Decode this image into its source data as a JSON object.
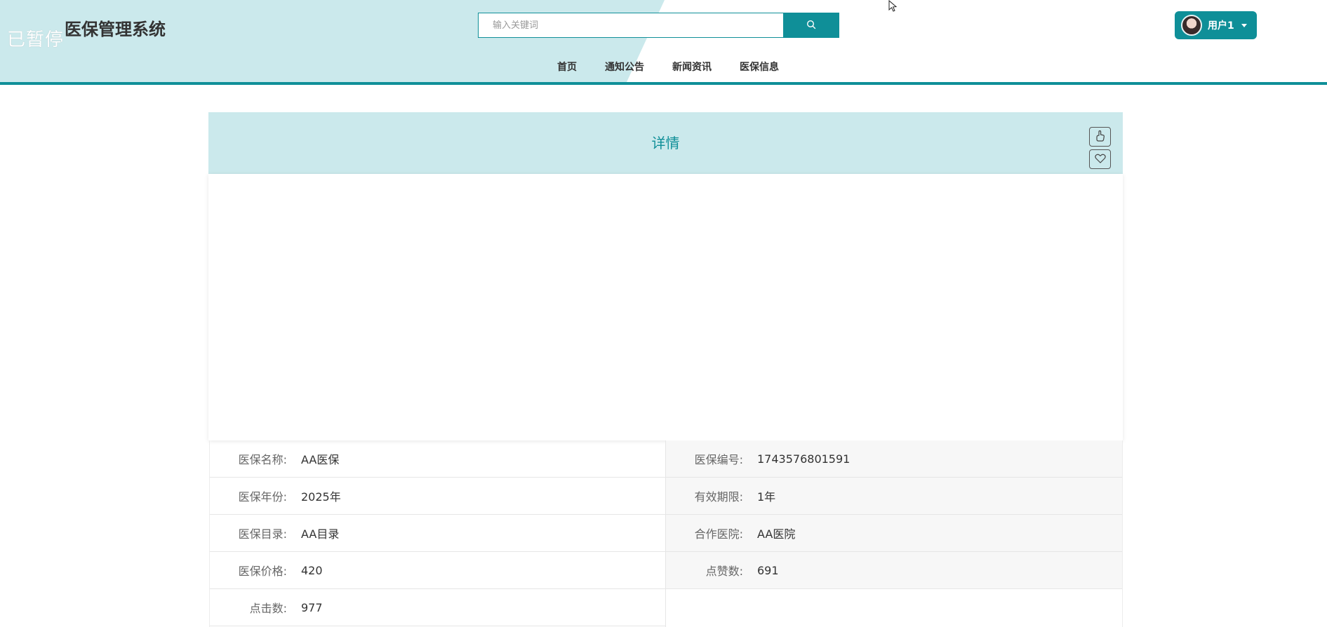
{
  "header": {
    "overlay_text": "已暂停",
    "site_title": "医保管理系统",
    "search": {
      "placeholder": "输入关键词",
      "value": ""
    },
    "nav": [
      "首页",
      "通知公告",
      "新闻资讯",
      "医保信息"
    ],
    "user": {
      "name": "用户1"
    }
  },
  "detail": {
    "title": "详情",
    "fields": {
      "left": [
        {
          "label": "医保名称:",
          "value": "AA医保"
        },
        {
          "label": "医保年份:",
          "value": "2025年"
        },
        {
          "label": "医保目录:",
          "value": "AA目录"
        },
        {
          "label": "医保价格:",
          "value": "420"
        },
        {
          "label": "点击数:",
          "value": "977"
        }
      ],
      "right": [
        {
          "label": "医保编号:",
          "value": "1743576801591"
        },
        {
          "label": "有效期限:",
          "value": "1年"
        },
        {
          "label": "合作医院:",
          "value": "AA医院"
        },
        {
          "label": "点赞数:",
          "value": "691"
        }
      ]
    }
  },
  "colors": {
    "accent": "#0f8f98",
    "header_bg": "#cbe9ec"
  },
  "icons": [
    "search-icon",
    "like-icon",
    "favorite-icon",
    "caret-down-icon",
    "mouse-cursor-icon"
  ]
}
